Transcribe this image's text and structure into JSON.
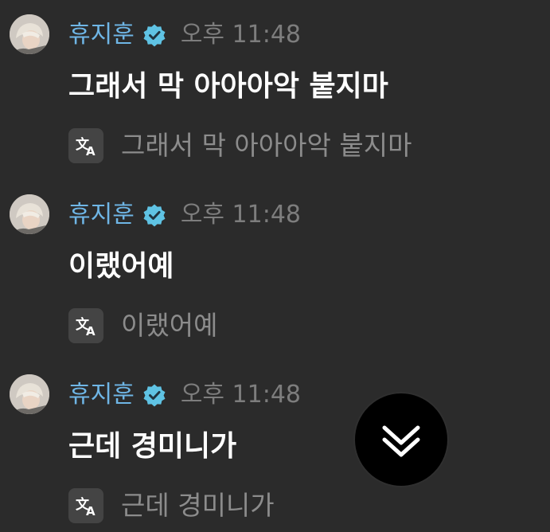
{
  "messages": [
    {
      "sender": "휴지훈",
      "time": "오후 11:48",
      "text": "그래서 막 아아아악 붙지마",
      "translation": "그래서 막 아아아악 붙지마"
    },
    {
      "sender": "휴지훈",
      "time": "오후 11:48",
      "text": "이랬어예",
      "translation": "이랬어예"
    },
    {
      "sender": "휴지훈",
      "time": "오후 11:48",
      "text": "근데 경미니가",
      "translation": "근데 경미니가"
    }
  ],
  "icons": {
    "verified": "verified-badge-icon",
    "translate": "translate-icon",
    "scroll_down": "chevrons-down-icon"
  },
  "colors": {
    "background": "#2b2b2b",
    "sender_name": "#6fb6e6",
    "verified_badge": "#5fc3e4",
    "timestamp": "#7d7d7d",
    "message_text": "#ffffff",
    "translation_text": "#8c8c8c",
    "scroll_button": "#000000"
  }
}
